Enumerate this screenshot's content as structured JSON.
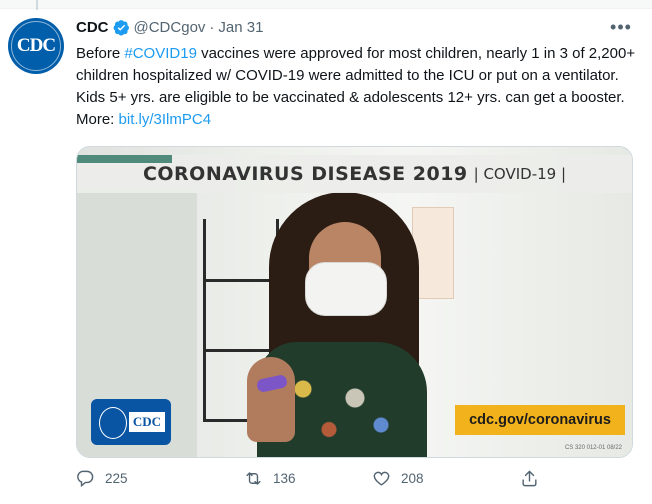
{
  "tweet": {
    "author": "CDC",
    "handle": "@CDCgov",
    "date": "Jan 31",
    "separator": "·",
    "text_before": "Before ",
    "hashtag": "#COVID19",
    "text_after": " vaccines were approved for most children, nearly 1 in 3 of 2,200+ children hospitalized w/ COVID-19 were admitted to the ICU or put on a ventilator. Kids 5+ yrs. are eligible to be vaccinated & adolescents 12+ yrs. can get a booster. More: ",
    "link": "bit.ly/3IlmPC4",
    "more_icon": "more-horizontal-icon"
  },
  "avatar": {
    "label": "CDC"
  },
  "media": {
    "banner_title": "CORONAVIRUS DISEASE 2019",
    "banner_sub": "| COVID-19 |",
    "logo_text": "CDC",
    "url_label": "cdc.gov/coronavirus",
    "fine_print": "CS 320 012-01 08/22"
  },
  "actions": {
    "reply": "225",
    "retweet": "136",
    "like": "208"
  },
  "colors": {
    "link": "#1d9bf0",
    "muted": "#536471",
    "cdc_blue": "#005eaa",
    "accent_yellow": "#f2b21b"
  }
}
